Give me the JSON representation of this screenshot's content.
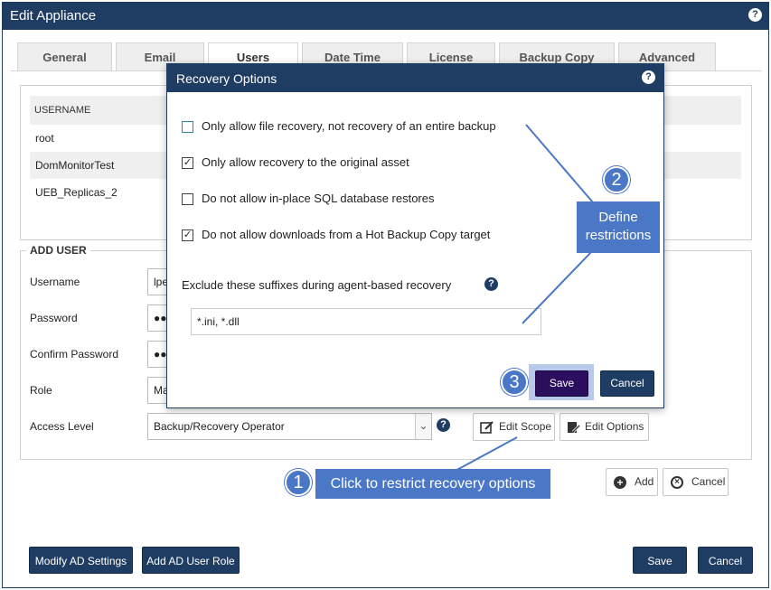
{
  "window": {
    "title": "Edit Appliance"
  },
  "tabs": [
    "General",
    "Email",
    "Users",
    "Date Time",
    "License",
    "Backup Copy",
    "Advanced"
  ],
  "users_table": {
    "header": "USERNAME",
    "rows": [
      "root",
      "DomMonitorTest",
      "UEB_Replicas_2"
    ]
  },
  "add_user": {
    "legend": "ADD USER",
    "username_label": "Username",
    "username_value": "lpe",
    "password_label": "Password",
    "password_value": "●●",
    "confirm_label": "Confirm Password",
    "confirm_value": "●●",
    "role_label": "Role",
    "role_value": "Ma",
    "access_label": "Access Level",
    "access_value": "Backup/Recovery Operator",
    "edit_scope": "Edit Scope",
    "edit_options": "Edit Options",
    "add": "Add",
    "cancel": "Cancel"
  },
  "footer": {
    "modify_ad": "Modify AD Settings",
    "add_ad_role": "Add AD User Role",
    "save": "Save",
    "cancel": "Cancel"
  },
  "dialog": {
    "title": "Recovery Options",
    "options": [
      {
        "label": "Only allow file recovery, not recovery of an entire backup",
        "checked": false
      },
      {
        "label": "Only allow recovery to the original asset",
        "checked": true
      },
      {
        "label": "Do not allow in-place SQL database restores",
        "checked": false
      },
      {
        "label": "Do not allow downloads from a Hot Backup Copy target",
        "checked": true
      }
    ],
    "suffix_label": "Exclude these suffixes during agent-based recovery",
    "suffix_value": "*.ini, *.dll",
    "save": "Save",
    "cancel": "Cancel"
  },
  "callouts": {
    "one_num": "1",
    "one_text": "Click to restrict recovery options",
    "two_num": "2",
    "two_text_line1": "Define",
    "two_text_line2": "restrictions",
    "three_num": "3"
  },
  "colors": {
    "navy": "#1f3d63",
    "callout_blue": "#4b78c6",
    "dialog_save": "#2b0f5e"
  }
}
